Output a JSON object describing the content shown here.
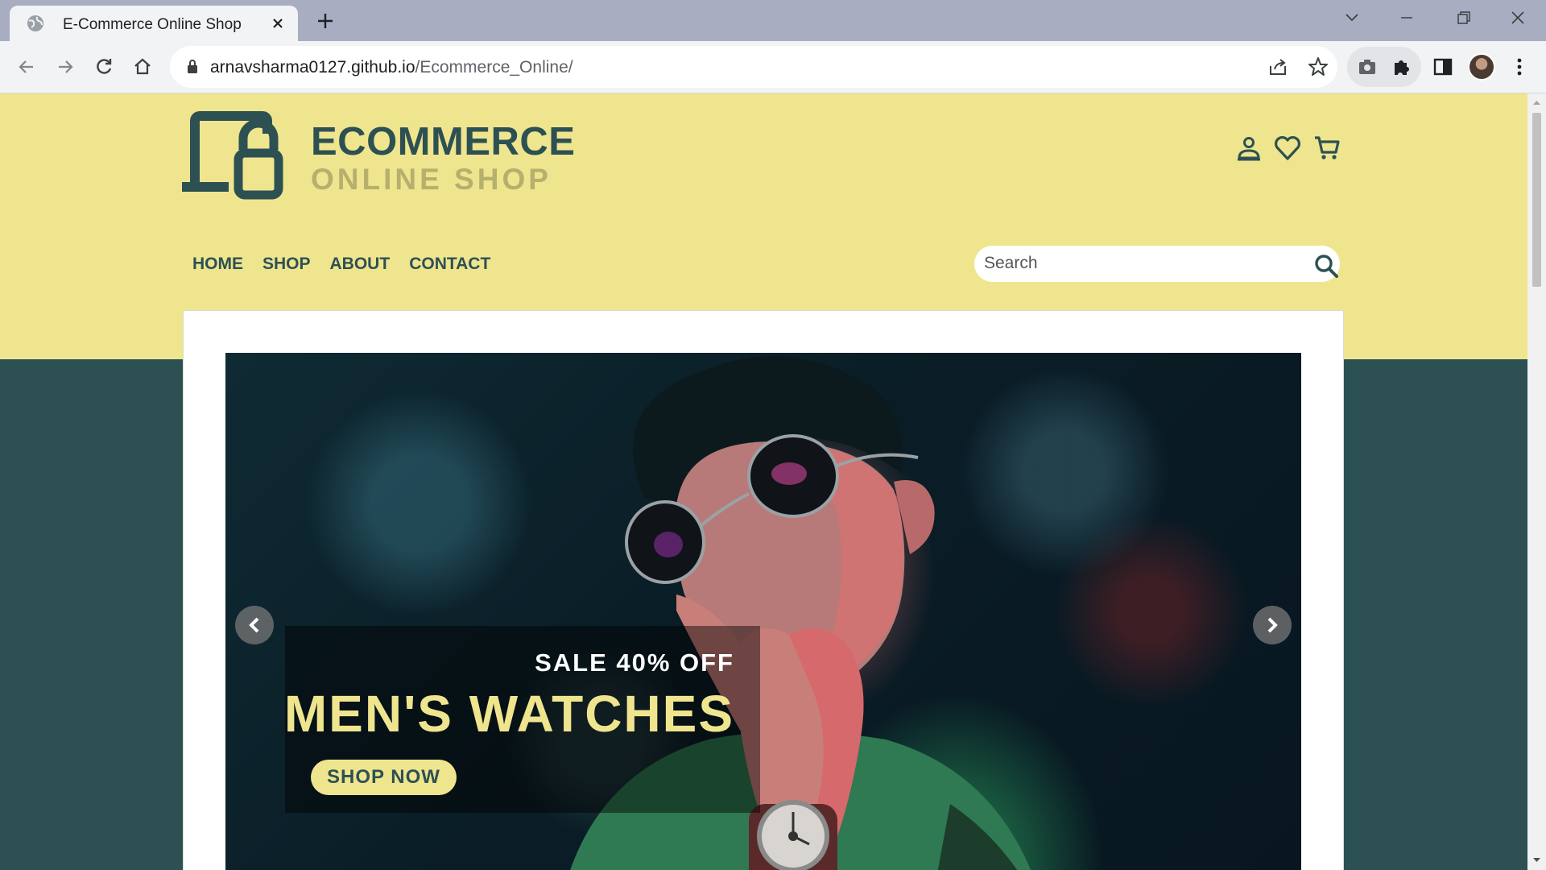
{
  "browser": {
    "tab_title": "E-Commerce Online Shop",
    "url_domain": "arnavsharma0127.github.io",
    "url_path": "/Ecommerce_Online/"
  },
  "site": {
    "brand_top": "ECOMMERCE",
    "brand_bottom": "ONLINE SHOP",
    "nav": [
      "HOME",
      "SHOP",
      "ABOUT",
      "CONTACT"
    ],
    "search_placeholder": "Search"
  },
  "hero": {
    "sale_text": "SALE 40% OFF",
    "headline": "MEN'S WATCHES",
    "cta": "SHOP NOW"
  },
  "colors": {
    "header_yellow": "#efe58e",
    "teal": "#2d5153",
    "brand_muted": "#b6af6e"
  },
  "icons": [
    "globe-favicon-icon",
    "close-icon",
    "plus-icon",
    "back-icon",
    "forward-icon",
    "reload-icon",
    "home-icon",
    "lock-icon",
    "share-icon",
    "star-icon",
    "extension-icon",
    "puzzle-icon",
    "side-panel-icon",
    "menu-dots-icon",
    "user-icon",
    "heart-icon",
    "cart-icon",
    "search-icon",
    "chevron-left-icon",
    "chevron-right-icon"
  ]
}
